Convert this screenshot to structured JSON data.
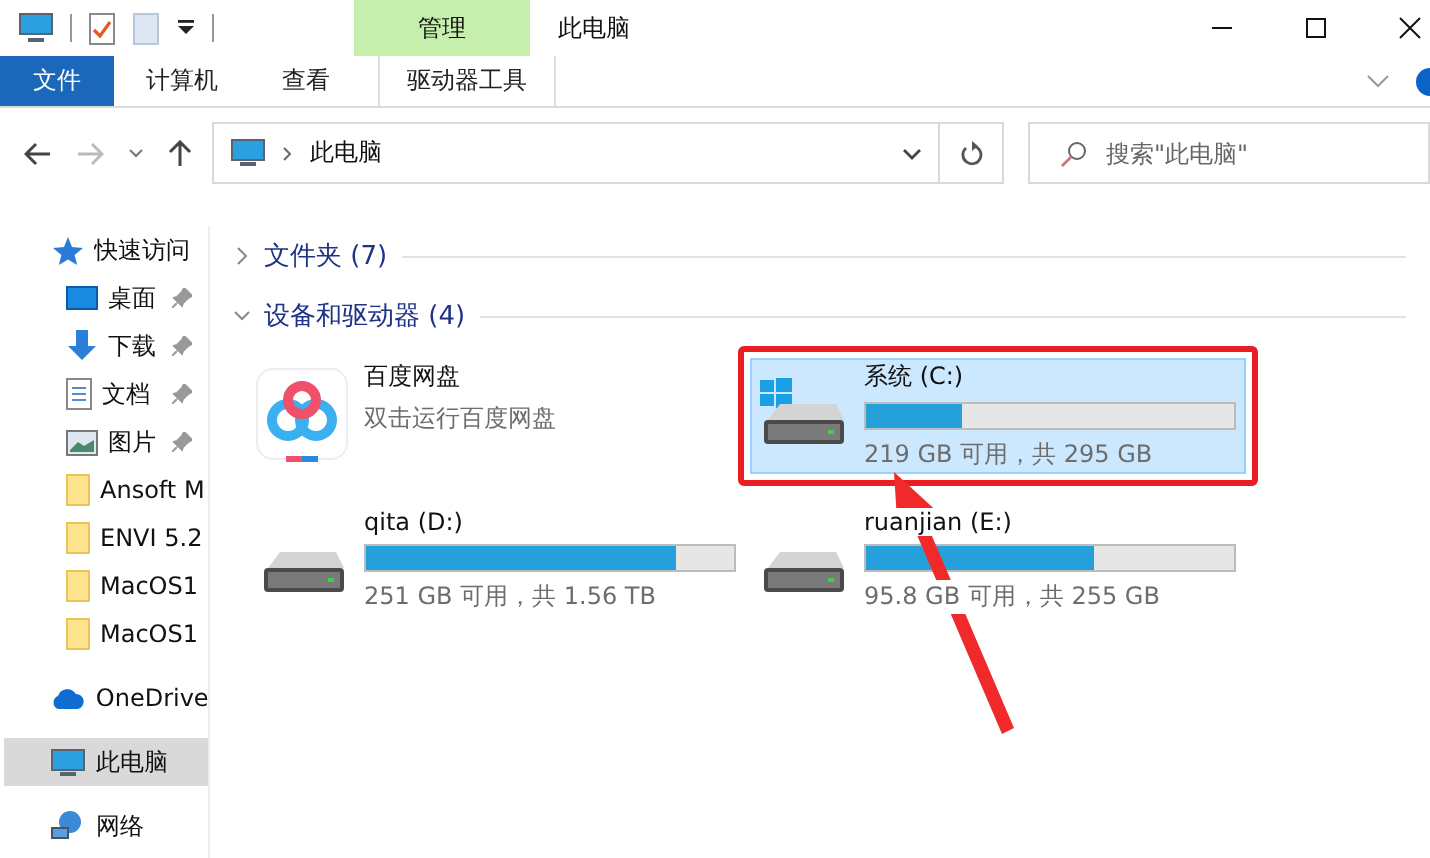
{
  "title_bar": {
    "contextual_tab": "管理",
    "title": "此电脑"
  },
  "ribbon_tabs": [
    {
      "label": "文件",
      "kind": "file"
    },
    {
      "label": "计算机",
      "kind": "normal"
    },
    {
      "label": "查看",
      "kind": "normal"
    },
    {
      "label": "驱动器工具",
      "kind": "contextual"
    }
  ],
  "address": {
    "path": "此电脑"
  },
  "search": {
    "placeholder": "搜索\"此电脑\""
  },
  "sidebar": {
    "items": [
      {
        "label": "快速访问",
        "kind": "quick-access",
        "pinned": false,
        "selected": false
      },
      {
        "label": "桌面",
        "kind": "desktop",
        "pinned": true,
        "selected": false
      },
      {
        "label": "下载",
        "kind": "downloads",
        "pinned": true,
        "selected": false
      },
      {
        "label": "文档",
        "kind": "documents",
        "pinned": true,
        "selected": false
      },
      {
        "label": "图片",
        "kind": "pictures",
        "pinned": true,
        "selected": false
      },
      {
        "label": "Ansoft M",
        "kind": "folder",
        "pinned": false,
        "selected": false
      },
      {
        "label": "ENVI 5.2",
        "kind": "folder",
        "pinned": false,
        "selected": false
      },
      {
        "label": "MacOS1",
        "kind": "folder",
        "pinned": false,
        "selected": false
      },
      {
        "label": "MacOS1",
        "kind": "folder",
        "pinned": false,
        "selected": false
      },
      {
        "label": "OneDrive",
        "kind": "onedrive",
        "pinned": false,
        "selected": false
      },
      {
        "label": "此电脑",
        "kind": "pc",
        "pinned": false,
        "selected": true
      },
      {
        "label": "网络",
        "kind": "network",
        "pinned": false,
        "selected": false
      }
    ]
  },
  "groups": [
    {
      "title": "文件夹 (7)",
      "expanded": false
    },
    {
      "title": "设备和驱动器 (4)",
      "expanded": true
    }
  ],
  "devices": [
    {
      "kind": "app",
      "name": "百度网盘",
      "subtitle": "双击运行百度网盘",
      "selected": false,
      "highlighted": false
    },
    {
      "kind": "system-drive",
      "name": "系统 (C:)",
      "level": 0.26,
      "reading": "219 GB 可用，共 295 GB",
      "selected": true,
      "highlighted": true
    },
    {
      "kind": "drive",
      "name": "qita (D:)",
      "level": 0.84,
      "reading": "251 GB 可用，共 1.56 TB",
      "selected": false,
      "highlighted": false
    },
    {
      "kind": "drive",
      "name": "ruanjian (E:)",
      "level": 0.62,
      "reading": "95.8 GB 可用，共 255 GB",
      "selected": false,
      "highlighted": false
    }
  ],
  "annotation": {
    "arrow": true
  }
}
